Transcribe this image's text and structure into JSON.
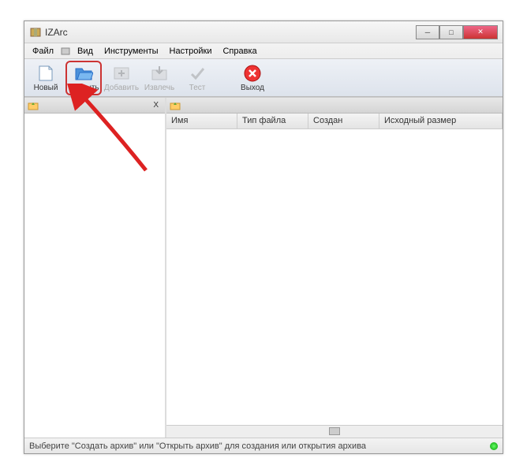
{
  "window": {
    "title": "IZArc"
  },
  "menu": {
    "file": "Файл",
    "view": "Вид",
    "tools": "Инструменты",
    "settings": "Настройки",
    "help": "Справка"
  },
  "toolbar": {
    "new": "Новый",
    "open": "Открыть",
    "add": "Добавить",
    "extract": "Извлечь",
    "test": "Тест",
    "exit": "Выход"
  },
  "left_header": {
    "close_x": "X"
  },
  "columns": {
    "name": "Имя",
    "type": "Тип файла",
    "created": "Создан",
    "original_size": "Исходный размер"
  },
  "status": {
    "text": "Выберите \"Создать архив\" или \"Открыть архив\" для создания или открытия архива"
  },
  "colors": {
    "highlight": "#c33",
    "accent_blue": "#2a6fc9"
  }
}
